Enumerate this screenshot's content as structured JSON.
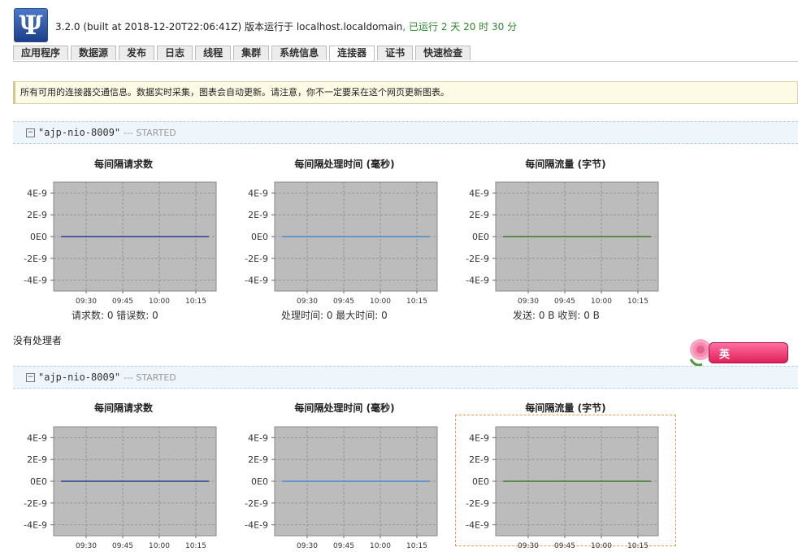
{
  "logo": {
    "glyph": "Ψ"
  },
  "header": {
    "version": "3.2.0 (built at 2018-12-20T22:06:41Z) 版本运行于 ",
    "host": "localhost.localdomain",
    "uptime": ", 已运行 2 天 20 时 30 分"
  },
  "tabs": [
    {
      "label": "应用程序"
    },
    {
      "label": "数据源"
    },
    {
      "label": "发布"
    },
    {
      "label": "日志"
    },
    {
      "label": "线程"
    },
    {
      "label": "集群"
    },
    {
      "label": "系统信息"
    },
    {
      "label": "连接器",
      "active": true
    },
    {
      "label": "证书"
    },
    {
      "label": "快速检查"
    }
  ],
  "notice": "所有可用的连接器交通信息。数据实时采集，图表会自动更新。请注意，你不一定要呆在这个网页更新图表。",
  "connectors": [
    {
      "name": "\"ajp-nio-8009\"",
      "state": "--- STARTED",
      "charts": {
        "requests_title": "每间隔请求数",
        "time_title": "每间隔处理时间 (毫秒)",
        "traffic_title": "每间隔流量 (字节)"
      },
      "stats": {
        "requests": "请求数: 0    错误数: 0",
        "time": "处理时间: 0    最大时间: 0",
        "traffic": "发送: 0 B    收到: 0 B"
      },
      "no_handler": "没有处理者"
    },
    {
      "name": "\"ajp-nio-8009\"",
      "state": "--- STARTED",
      "charts": {
        "requests_title": "每间隔请求数",
        "time_title": "每间隔处理时间 (毫秒)",
        "traffic_title": "每间隔流量 (字节)"
      }
    }
  ],
  "ime": {
    "label": "英"
  },
  "chart_data": [
    {
      "type": "line",
      "title": "每间隔请求数",
      "yticks": [
        "4E-9",
        "2E-9",
        "0E0",
        "-2E-9",
        "-4E-9"
      ],
      "xticks": [
        "09:30",
        "09:45",
        "10:00",
        "10:15"
      ],
      "series": [
        {
          "values": [
            0,
            0
          ]
        }
      ],
      "color": "#2a3e8a",
      "ylim": [
        -5e-09,
        5e-09
      ]
    },
    {
      "type": "line",
      "title": "每间隔处理时间 (毫秒)",
      "yticks": [
        "4E-9",
        "2E-9",
        "0E0",
        "-2E-9",
        "-4E-9"
      ],
      "xticks": [
        "09:30",
        "09:45",
        "10:00",
        "10:15"
      ],
      "series": [
        {
          "values": [
            0,
            0
          ]
        }
      ],
      "color": "#4a8ac8",
      "ylim": [
        -5e-09,
        5e-09
      ]
    },
    {
      "type": "line",
      "title": "每间隔流量 (字节)",
      "yticks": [
        "4E-9",
        "2E-9",
        "0E0",
        "-2E-9",
        "-4E-9"
      ],
      "xticks": [
        "09:30",
        "09:45",
        "10:00",
        "10:15"
      ],
      "series": [
        {
          "values": [
            0,
            0
          ]
        }
      ],
      "color": "#3a7a2a",
      "ylim": [
        -5e-09,
        5e-09
      ]
    }
  ]
}
